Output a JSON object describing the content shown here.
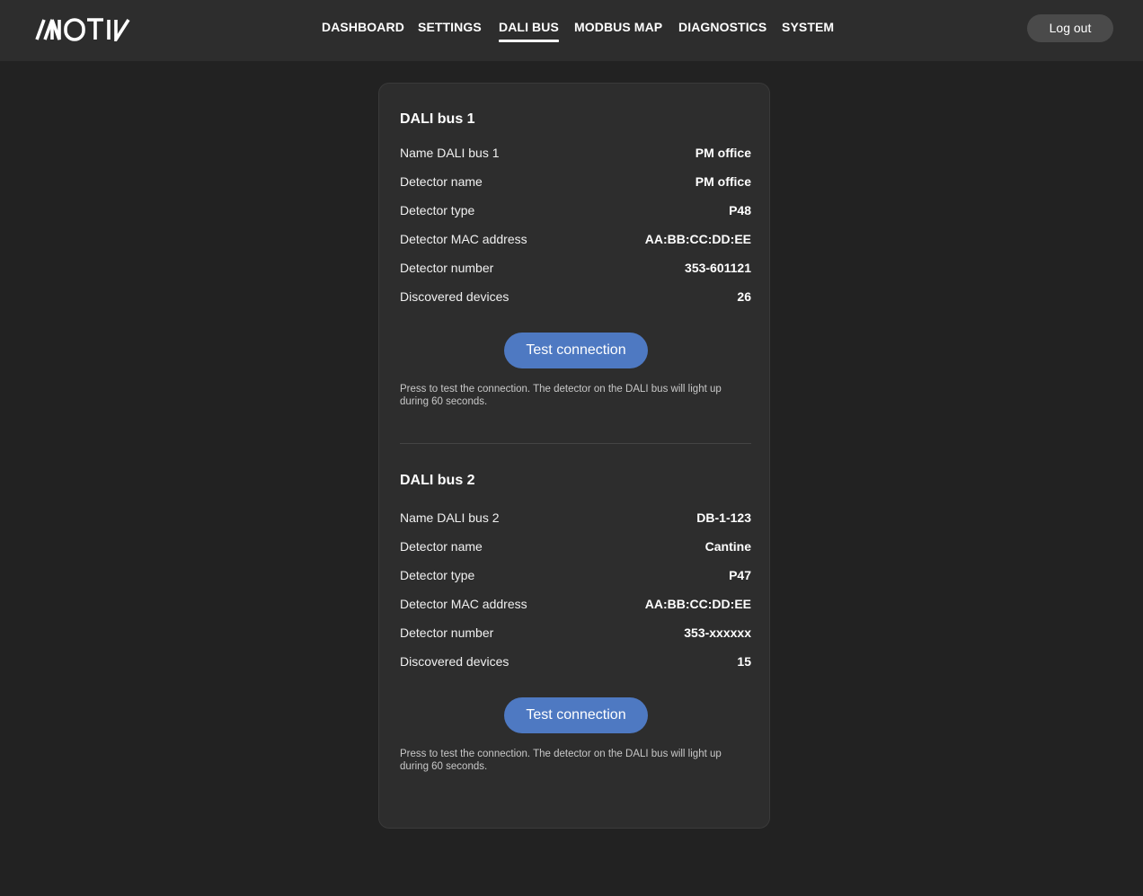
{
  "header": {
    "logo_text": "MOTIV",
    "nav": [
      {
        "label": "DASHBOARD"
      },
      {
        "label": "SETTINGS"
      },
      {
        "label": "DALI BUS"
      },
      {
        "label": "MODBUS MAP"
      },
      {
        "label": "DIAGNOSTICS"
      },
      {
        "label": "SYSTEM"
      }
    ],
    "active_nav": "DALI BUS",
    "logout_label": "Log out"
  },
  "buses": [
    {
      "title": "DALI bus 1",
      "rows": [
        {
          "label": "Name DALI bus 1",
          "value": "PM office"
        },
        {
          "label": "Detector name",
          "value": "PM office"
        },
        {
          "label": "Detector type",
          "value": "P48"
        },
        {
          "label": "Detector MAC address",
          "value": "AA:BB:CC:DD:EE"
        },
        {
          "label": "Detector number",
          "value": "353-601121"
        },
        {
          "label": "Discovered devices",
          "value": "26"
        }
      ],
      "button_label": "Test connection",
      "hint_line1": "Press to test the connection. The detector on the DALI bus will light up",
      "hint_line2": "during 60 seconds."
    },
    {
      "title": "DALI bus 2",
      "rows": [
        {
          "label": "Name DALI bus 2",
          "value": "DB-1-123"
        },
        {
          "label": "Detector name",
          "value": "Cantine"
        },
        {
          "label": "Detector type",
          "value": "P47"
        },
        {
          "label": "Detector MAC address",
          "value": "AA:BB:CC:DD:EE"
        },
        {
          "label": "Detector number",
          "value": "353-xxxxxx"
        },
        {
          "label": "Discovered devices",
          "value": "15"
        }
      ],
      "button_label": "Test connection",
      "hint_line1": "Press to test the connection. The detector on the DALI bus will light up",
      "hint_line2": "during 60 seconds."
    }
  ],
  "colors": {
    "background": "#222222",
    "topbar": "#2d2d2d",
    "card": "#2d2d2d",
    "accent_button": "#4e79c2",
    "logout_button": "#4a4a4a"
  }
}
